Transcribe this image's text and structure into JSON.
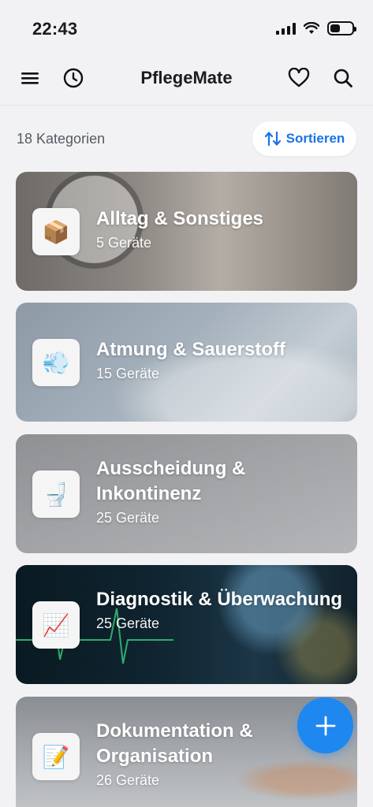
{
  "status_bar": {
    "time": "22:43"
  },
  "nav": {
    "title": "PflegeMate"
  },
  "toolbar": {
    "count_label": "18 Kategorien",
    "sort_label": "Sortieren"
  },
  "categories": [
    {
      "title": "Alltag & Sonstiges",
      "subtitle": "5 Geräte",
      "icon": "package-icon"
    },
    {
      "title": "Atmung & Sauerstoff",
      "subtitle": "15 Geräte",
      "icon": "dash-cloud-icon"
    },
    {
      "title": "Ausscheidung & Inkontinenz",
      "subtitle": "25 Geräte",
      "icon": "toilet-icon"
    },
    {
      "title": "Diagnostik & Überwachung",
      "subtitle": "25 Geräte",
      "icon": "chart-increasing-icon"
    },
    {
      "title": "Dokumentation & Organisation",
      "subtitle": "26 Geräte",
      "icon": "memo-icon"
    }
  ],
  "colors": {
    "accent": "#1e87f0",
    "background": "#f2f2f4"
  }
}
